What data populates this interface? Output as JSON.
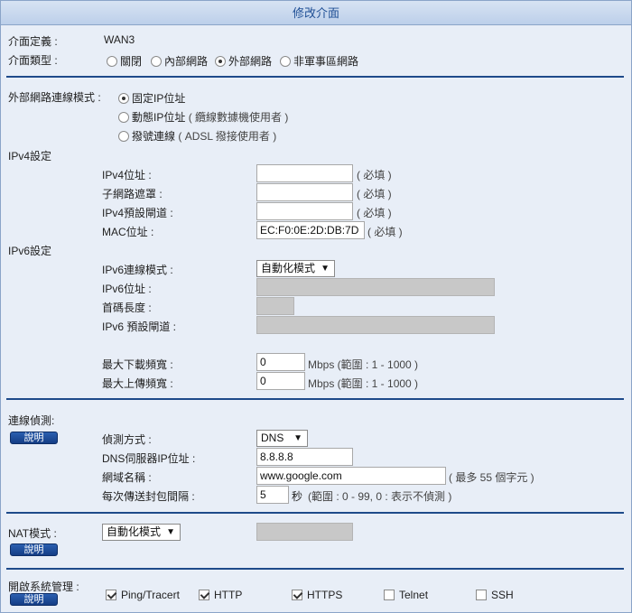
{
  "title": "修改介面",
  "iface": {
    "def_label": "介面定義 :",
    "def_value": "WAN3",
    "type_label": "介面類型 :",
    "types": [
      "關閉",
      "內部網路",
      "外部網路",
      "非軍事區網路"
    ]
  },
  "wan_mode": {
    "label": "外部網路連線模式 :",
    "options": [
      {
        "main": "固定IP位址",
        "note": ""
      },
      {
        "main": "動態IP位址",
        "note": "( 纜線數據機使用者 )"
      },
      {
        "main": "撥號連線",
        "note": "( ADSL 撥接使用者 )"
      }
    ]
  },
  "ipv4": {
    "section": "IPv4設定",
    "ip_label": "IPv4位址 :",
    "mask_label": "子網路遮罩 :",
    "gw_label": "IPv4預設閘道 :",
    "mac_label": "MAC位址 :",
    "mac_value": "EC:F0:0E:2D:DB:7D",
    "required": "( 必填 )"
  },
  "ipv6": {
    "section": "IPv6設定",
    "mode_label": "IPv6連線模式 :",
    "mode_value": "自動化模式",
    "ip_label": "IPv6位址 :",
    "prefix_label": "首碼長度 :",
    "gw_label": "IPv6 預設閘道 :"
  },
  "bandwidth": {
    "down_label": "最大下載頻寬 :",
    "down_value": "0",
    "up_label": "最大上傳頻寬 :",
    "up_value": "0",
    "unit_note": "Mbps (範圍 : 1 - 1000 )"
  },
  "detect": {
    "label": "連線偵測:",
    "help": "說明",
    "method_label": "偵測方式 :",
    "method_value": "DNS",
    "dns_label": "DNS伺服器IP位址 :",
    "dns_value": "8.8.8.8",
    "domain_label": "網域名稱 :",
    "domain_value": "www.google.com",
    "domain_note": "( 最多 55 個字元 )",
    "interval_label": "每次傳送封包間隔 :",
    "interval_value": "5",
    "interval_unit": "秒",
    "interval_note": "(範圍 : 0 - 99, 0 : 表示不偵測 )"
  },
  "nat": {
    "label": "NAT模式 :",
    "help": "說明",
    "mode_value": "自動化模式"
  },
  "mgmt": {
    "label": "開啟系統管理 :",
    "help": "說明",
    "items": [
      "Ping/Tracert",
      "HTTP",
      "HTTPS",
      "Telnet",
      "SSH"
    ]
  }
}
